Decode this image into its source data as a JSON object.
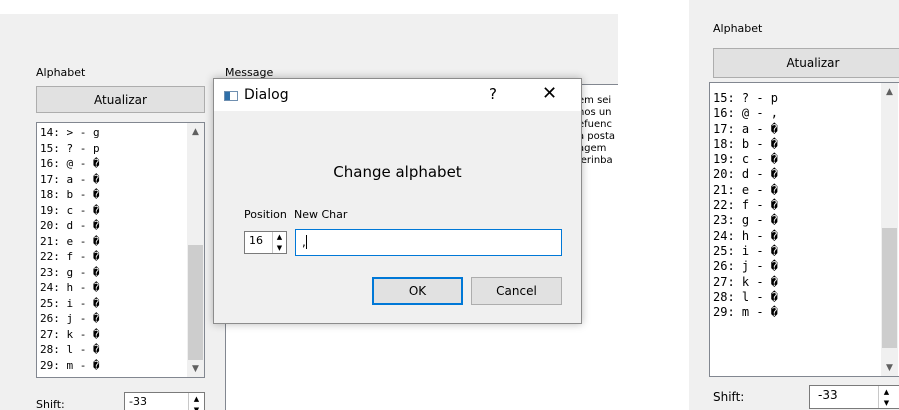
{
  "main_window": {
    "alphabet_label": "Alphabet",
    "update_button": "Atualizar",
    "message_label": "Message",
    "list_items": [
      "14: > - g",
      "15: ? - p",
      "16: @ - �",
      "17: a - �",
      "18: b - �",
      "19: c - �",
      "20: d - �",
      "21: e - �",
      "22: f - �",
      "23: g - �",
      "24: h - �",
      "25: i - �",
      "26: j - �",
      "27: k - �",
      "28: l - �",
      "29: m - �"
    ],
    "message_fragments": [
      "em sei",
      "nos un",
      "efuenc",
      "a posta",
      "agem",
      "lerinba"
    ],
    "shift_label": "Shift:",
    "shift_value": "-33"
  },
  "dialog": {
    "title": "Dialog",
    "help_icon": "?",
    "close_icon": "✕",
    "heading": "Change alphabet",
    "position_label": "Position",
    "new_char_label": "New Char",
    "position_value": "16",
    "new_char_value": ",",
    "ok_button": "OK",
    "cancel_button": "Cancel"
  },
  "second_window": {
    "alphabet_label": "Alphabet",
    "update_button": "Atualizar",
    "list_items": [
      "15: ? - p",
      "16: @ - ,",
      "17: a - �",
      "18: b - �",
      "19: c - �",
      "20: d - �",
      "21: e - �",
      "22: f - �",
      "23: g - �",
      "24: h - �",
      "25: i - �",
      "26: j - �",
      "27: k - �",
      "28: l - �",
      "29: m - �"
    ],
    "shift_label": "Shift:",
    "shift_value": "-33"
  },
  "icons": {
    "scroll_up": "▲",
    "scroll_down": "▼",
    "spin_up": "▲",
    "spin_down": "▼"
  },
  "colors": {
    "focus_border": "#0078d7",
    "window_bg": "#f0f0f0"
  }
}
